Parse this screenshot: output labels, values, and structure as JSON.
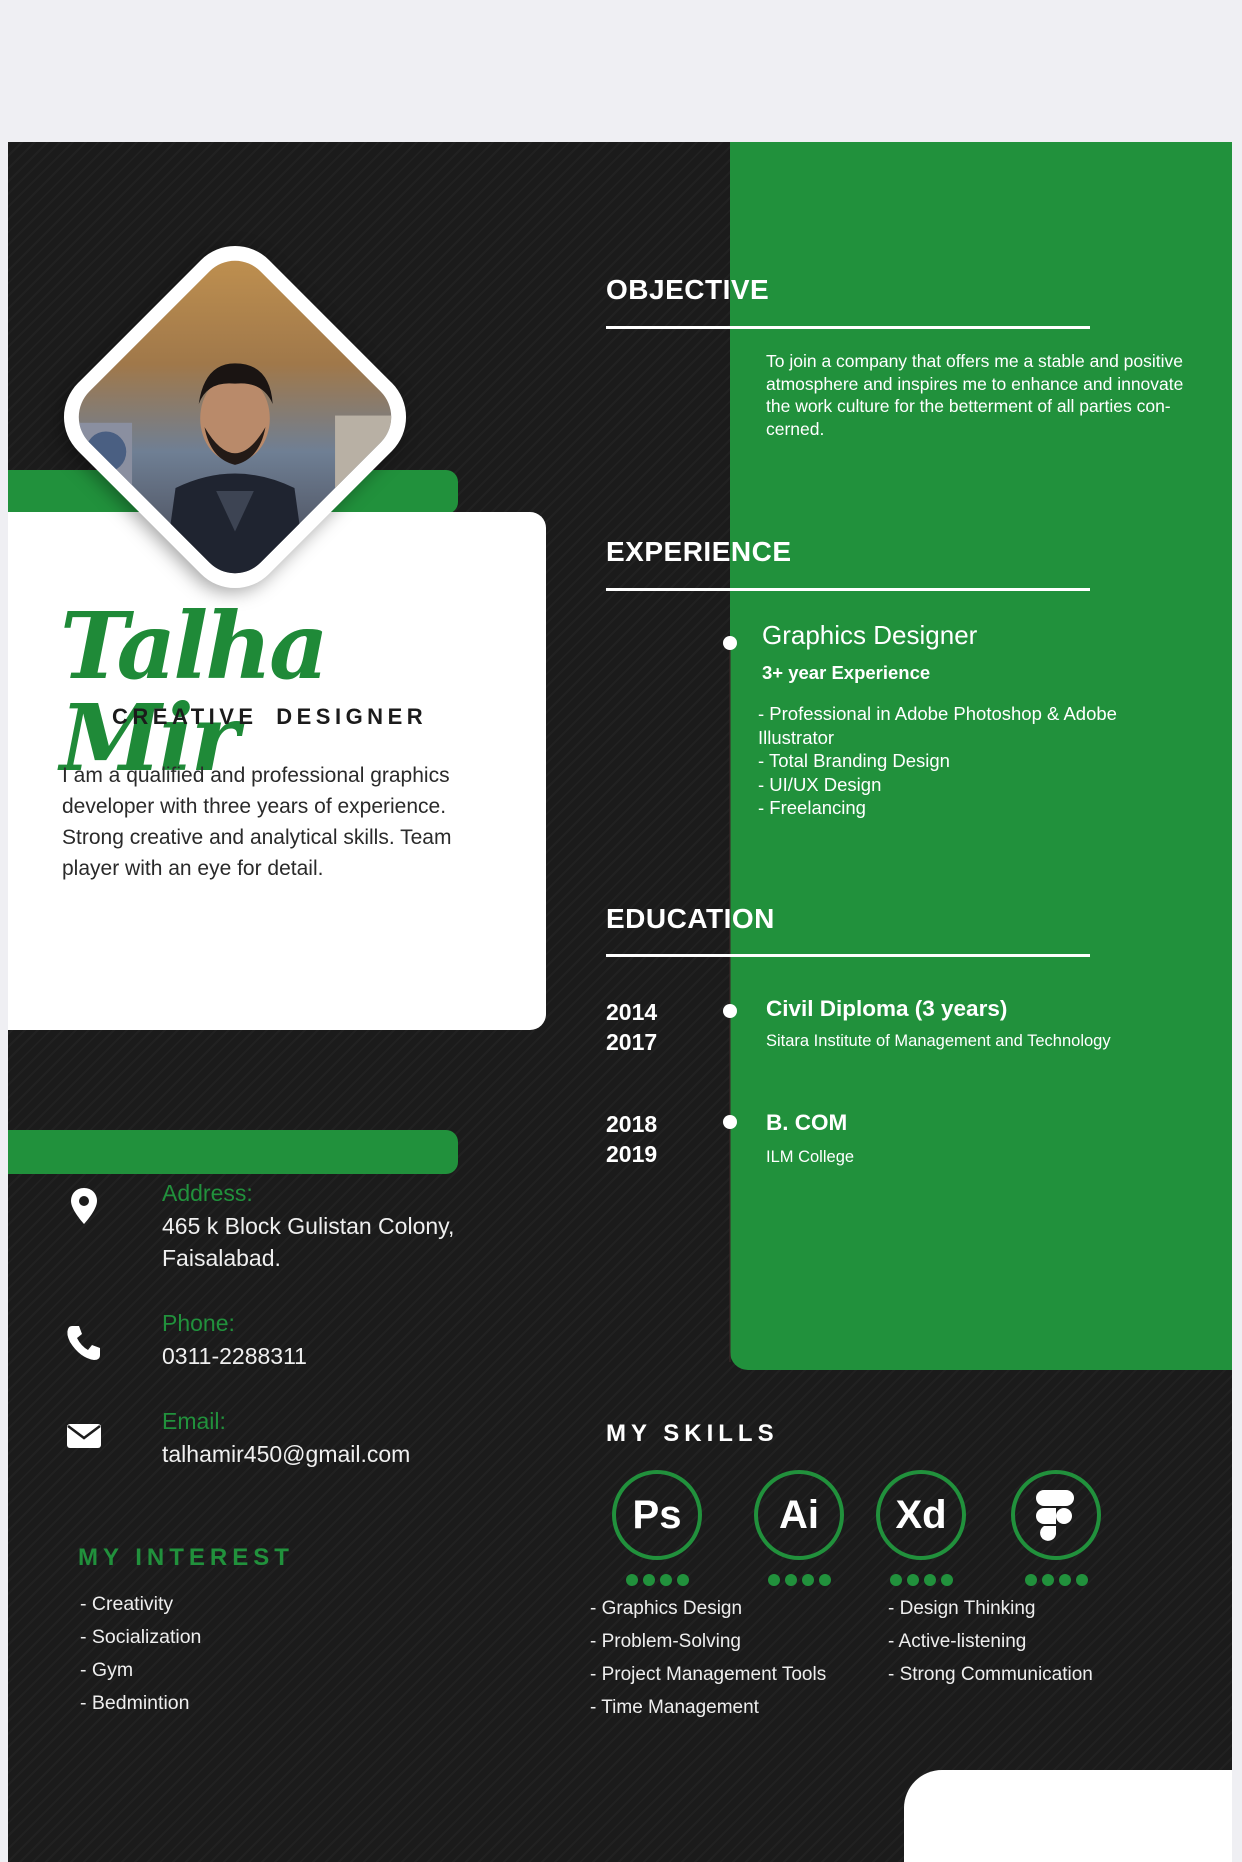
{
  "profile": {
    "name": "Talha Mir",
    "role": "CREATIVE DESIGNER",
    "about": "I am a qualified and professional graphics developer with three years of experience. Strong creative and analytical skills. Team player with an eye for detail."
  },
  "contact": {
    "address_label": "Address:",
    "address_value": "465 k Block Gulistan Colony, Faisalabad.",
    "phone_label": "Phone:",
    "phone_value": "0311-2288311",
    "email_label": "Email:",
    "email_value": "talhamir450@gmail.com"
  },
  "interests": {
    "title": "MY INTEREST",
    "items": [
      "- Creativity",
      "- Socialization",
      "- Gym",
      "- Bedmintion"
    ]
  },
  "objective": {
    "title": "OBJECTIVE",
    "text": "To join a company that offers me a stable and positive atmosphere and inspires me to enhance and innovate the work culture for the betterment of all parties con- cerned."
  },
  "experience": {
    "title": "EXPERIENCE",
    "job_title": "Graphics Designer",
    "job_sub": "3+ year Experience",
    "points": [
      "- Professional in Adobe Photoshop & Adobe Illustrator",
      "- Total Branding Design",
      "- UI/UX Design",
      "- Freelancing"
    ]
  },
  "education": {
    "title": "EDUCATION",
    "entries": [
      {
        "year_start": "2014",
        "year_end": "2017",
        "degree": "Civil Diploma (3 years)",
        "institute": "Sitara Institute of Management and Technology"
      },
      {
        "year_start": "2018",
        "year_end": "2019",
        "degree": "B. COM",
        "institute": "ILM College"
      }
    ]
  },
  "skills": {
    "title": "MY SKILLS",
    "tools": [
      {
        "label": "Ps",
        "icon": "photoshop-icon",
        "rating": 4
      },
      {
        "label": "Ai",
        "icon": "illustrator-icon",
        "rating": 4
      },
      {
        "label": "Xd",
        "icon": "xd-icon",
        "rating": 4
      },
      {
        "label": "",
        "icon": "figma-icon",
        "rating": 4
      }
    ],
    "list_left": [
      "- Graphics Design",
      "- Problem-Solving",
      "- Project Management Tools",
      "- Time Management"
    ],
    "list_right": [
      "- Design Thinking",
      "- Active-listening",
      "- Strong Communication"
    ]
  },
  "colors": {
    "accent": "#21913c",
    "background": "#1b1b1b",
    "card": "#ffffff"
  }
}
